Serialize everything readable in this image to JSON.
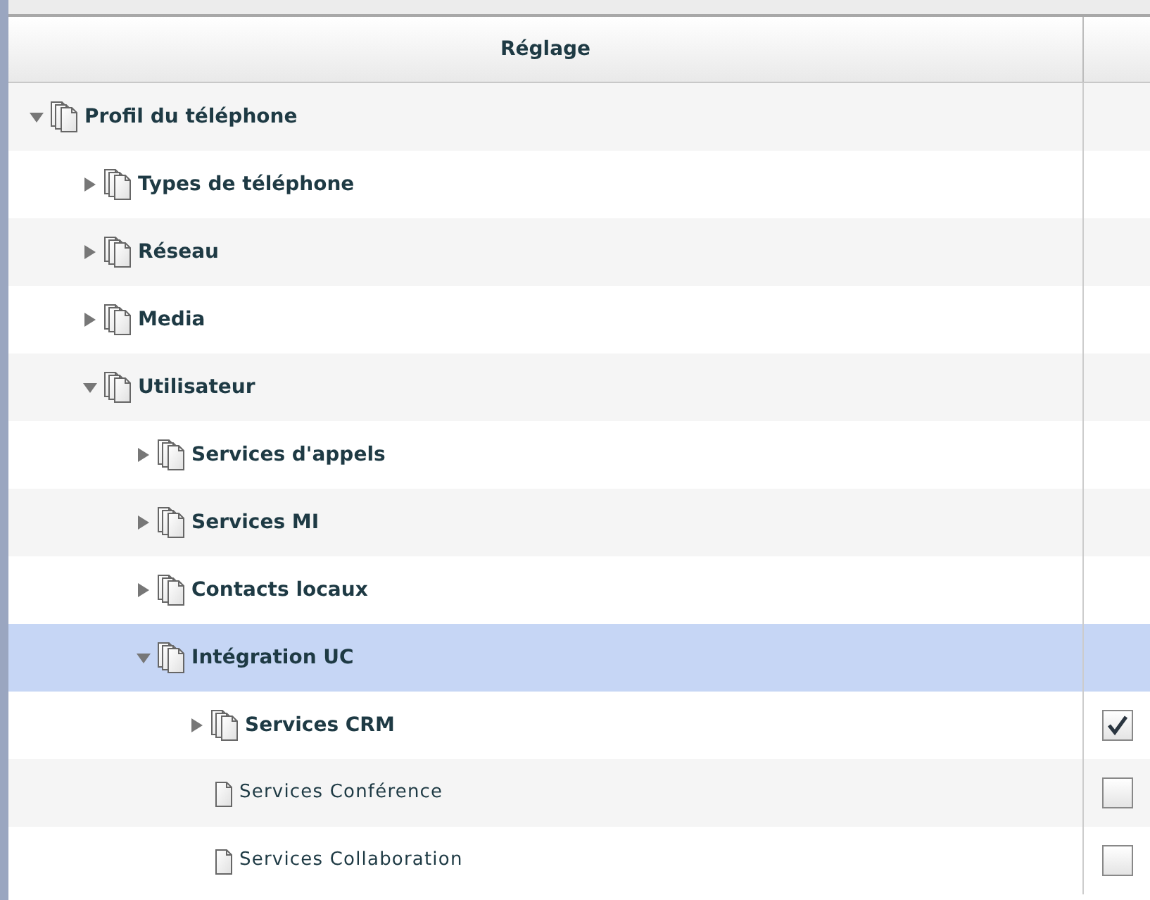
{
  "columns": [
    "Réglage"
  ],
  "tree": [
    {
      "label": "Profil du téléphone",
      "kind": "folder",
      "expanded": true,
      "selected": false,
      "children": [
        {
          "label": "Types de téléphone",
          "kind": "folder",
          "expanded": false,
          "selected": false
        },
        {
          "label": "Réseau",
          "kind": "folder",
          "expanded": false,
          "selected": false
        },
        {
          "label": "Media",
          "kind": "folder",
          "expanded": false,
          "selected": false
        },
        {
          "label": "Utilisateur",
          "kind": "folder",
          "expanded": true,
          "selected": false,
          "children": [
            {
              "label": "Services d'appels",
              "kind": "folder",
              "expanded": false,
              "selected": false
            },
            {
              "label": "Services MI",
              "kind": "folder",
              "expanded": false,
              "selected": false
            },
            {
              "label": "Contacts locaux",
              "kind": "folder",
              "expanded": false,
              "selected": false
            },
            {
              "label": "Intégration UC",
              "kind": "folder",
              "expanded": true,
              "selected": true,
              "children": [
                {
                  "label": "Services CRM",
                  "kind": "folder",
                  "expanded": false,
                  "selected": false,
                  "checked": true
                },
                {
                  "label": "Services Conférence",
                  "kind": "leaf",
                  "selected": false,
                  "checked": false
                },
                {
                  "label": "Services Collaboration",
                  "kind": "leaf",
                  "selected": false,
                  "checked": false
                }
              ]
            }
          ]
        }
      ]
    }
  ]
}
